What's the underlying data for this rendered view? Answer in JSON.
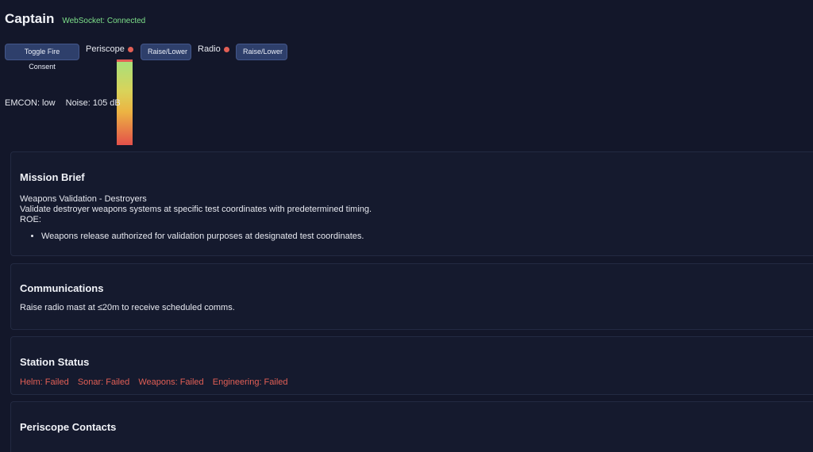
{
  "header": {
    "title": "Captain",
    "websocket_status": "WebSocket: Connected"
  },
  "controls": {
    "fire_consent_label": "Toggle Fire Consent",
    "periscope_label": "Periscope",
    "periscope_button_label": "Raise/Lower",
    "radio_label": "Radio",
    "radio_button_label": "Raise/Lower",
    "indicator_color": "#e25f55"
  },
  "periscope_meter": {
    "level_fraction": 0.97
  },
  "status_line": {
    "emcon": "EMCON: low",
    "noise": "Noise: 105 dB"
  },
  "mission_brief": {
    "title": "Mission Brief",
    "name": "Weapons Validation - Destroyers",
    "description": "Validate destroyer weapons systems at specific test coordinates with predetermined timing.",
    "roe_label": "ROE:",
    "roe": [
      "Weapons release authorized for validation purposes at designated test coordinates."
    ]
  },
  "communications": {
    "title": "Communications",
    "text": "Raise radio mast at ≤20m to receive scheduled comms."
  },
  "station_status": {
    "title": "Station Status",
    "stations": [
      "Helm: Failed",
      "Sonar: Failed",
      "Weapons: Failed",
      "Engineering: Failed"
    ],
    "failed_color": "#e25f55"
  },
  "periscope_contacts": {
    "title": "Periscope Contacts"
  }
}
